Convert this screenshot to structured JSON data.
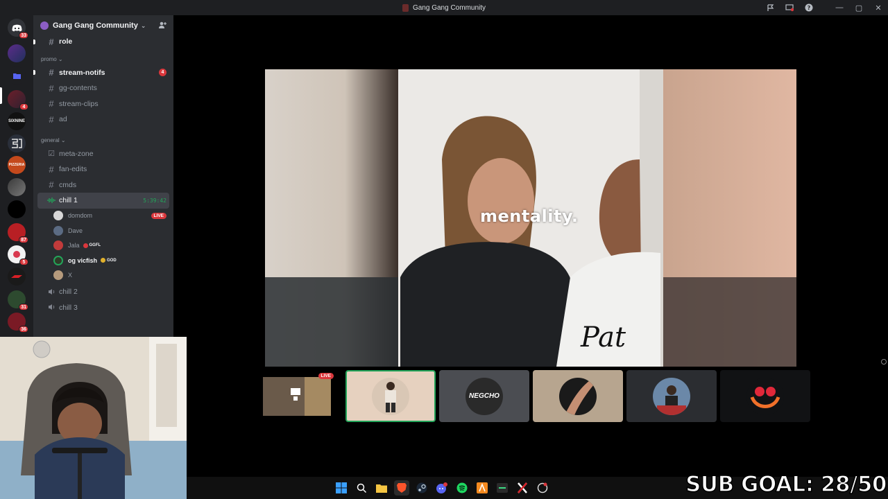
{
  "window": {
    "title": "Gang Gang Community"
  },
  "rail": {
    "badges": [
      "33",
      "4",
      "87",
      "5",
      "31",
      "36"
    ],
    "server_labels": [
      "SIXNINE",
      "PIZZERIA"
    ]
  },
  "guild": {
    "name": "Gang Gang Community"
  },
  "channels": {
    "top": [
      {
        "name": "role",
        "unread": true
      }
    ],
    "promo_label": "promo",
    "promo": [
      {
        "name": "stream-notifs",
        "unread": true,
        "mentions": "4"
      },
      {
        "name": "gg-contents"
      },
      {
        "name": "stream-clips"
      },
      {
        "name": "ad"
      }
    ],
    "general_label": "general",
    "general": [
      {
        "name": "meta-zone"
      },
      {
        "name": "fan-edits"
      },
      {
        "name": "cmds"
      }
    ],
    "voice_active": {
      "name": "chill 1",
      "timer": "5:39:42"
    },
    "voice_users": [
      {
        "name": "domdom",
        "live": "LIVE"
      },
      {
        "name": "Dave"
      },
      {
        "name": "Jala",
        "tag": "GGFL"
      },
      {
        "name": "og vicfish",
        "tag": "GOD"
      },
      {
        "name": "X"
      }
    ],
    "voice_other": [
      {
        "name": "chill 2"
      },
      {
        "name": "chill 3"
      }
    ]
  },
  "stream": {
    "caption": "mentality.",
    "tile_live": "LIVE",
    "tile_text": "NEGCHO"
  },
  "overlay": {
    "sub_goal": "SUB GOAL: 28/50"
  },
  "colors": {
    "accent_green": "#23a55a",
    "alert_red": "#da373c",
    "sidebar_bg": "#2b2d31",
    "rail_bg": "#1e1f22"
  }
}
